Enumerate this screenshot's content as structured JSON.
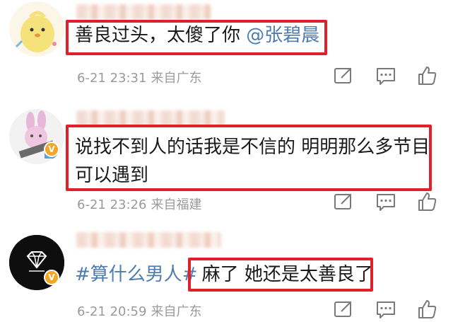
{
  "comments": [
    {
      "text": "善良过头，太傻了你 ",
      "mention": "@张碧晨",
      "time": "6-21 23:31",
      "source": "来自广东",
      "avatar": "cartoon-chick-avatar"
    },
    {
      "line1": "说找不到人的话我是不信的 明明那么多节目",
      "line2": "可以遇到",
      "time": "6-21 23:26",
      "source": "来自福建",
      "avatar": "pink-bunny-avatar"
    },
    {
      "hashtag": "#算什么男人#",
      "text": "麻了 她还是太善良了",
      "time": "6-21 20:59",
      "source": "来自广东",
      "avatar": "diamond-logo-avatar"
    }
  ],
  "icons": {
    "share": "share-icon",
    "comment": "comment-icon",
    "like": "thumbs-up-icon",
    "verified": "verified-badge-icon"
  },
  "colors": {
    "highlight": "#e0202a",
    "link": "#4f7cae",
    "meta": "#9a9a9a",
    "badge": "#f5a623"
  }
}
